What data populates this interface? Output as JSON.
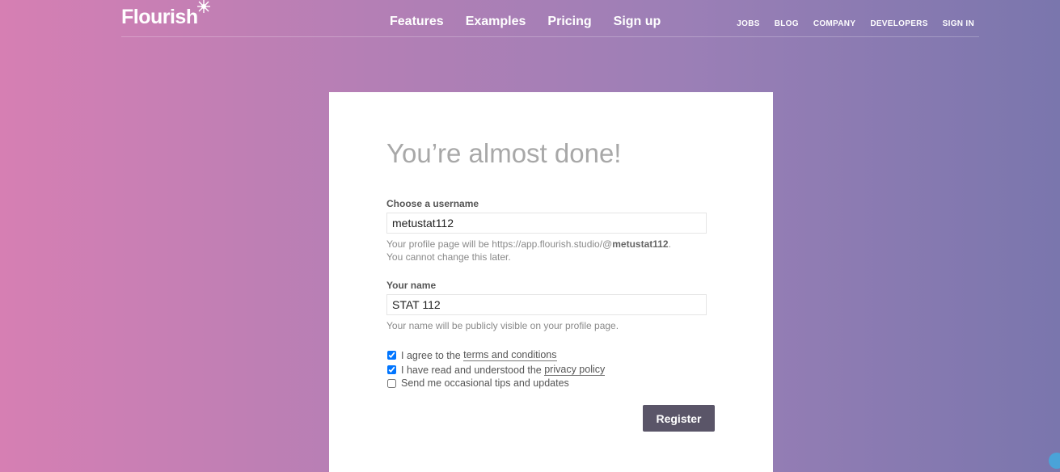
{
  "header": {
    "logo": "Flourish",
    "main_nav": [
      "Features",
      "Examples",
      "Pricing",
      "Sign up"
    ],
    "secondary_nav": [
      "JOBS",
      "BLOG",
      "COMPANY",
      "DEVELOPERS",
      "SIGN IN"
    ]
  },
  "form": {
    "title": "You’re almost done!",
    "username_label": "Choose a username",
    "username_value": "metustat112",
    "username_hint_prefix": "Your profile page will be https://app.flourish.studio/@",
    "username_hint_handle": "metustat112",
    "username_hint_suffix": ".",
    "username_hint_line2": "You cannot change this later.",
    "name_label": "Your name",
    "name_value": "STAT 112",
    "name_hint": "Your name will be publicly visible on your profile page.",
    "terms": {
      "prefix": "I agree to the ",
      "link": "terms and conditions",
      "checked": true
    },
    "privacy": {
      "prefix": "I have read and understood the ",
      "link": "privacy policy",
      "checked": true
    },
    "tips": {
      "text": "Send me occasional tips and updates",
      "checked": false
    },
    "register_label": "Register"
  },
  "colors": {
    "gradient_left": "#d67fb3",
    "gradient_right": "#7a76ad",
    "button": "#5a5568",
    "heading": "#a8a8a8"
  }
}
